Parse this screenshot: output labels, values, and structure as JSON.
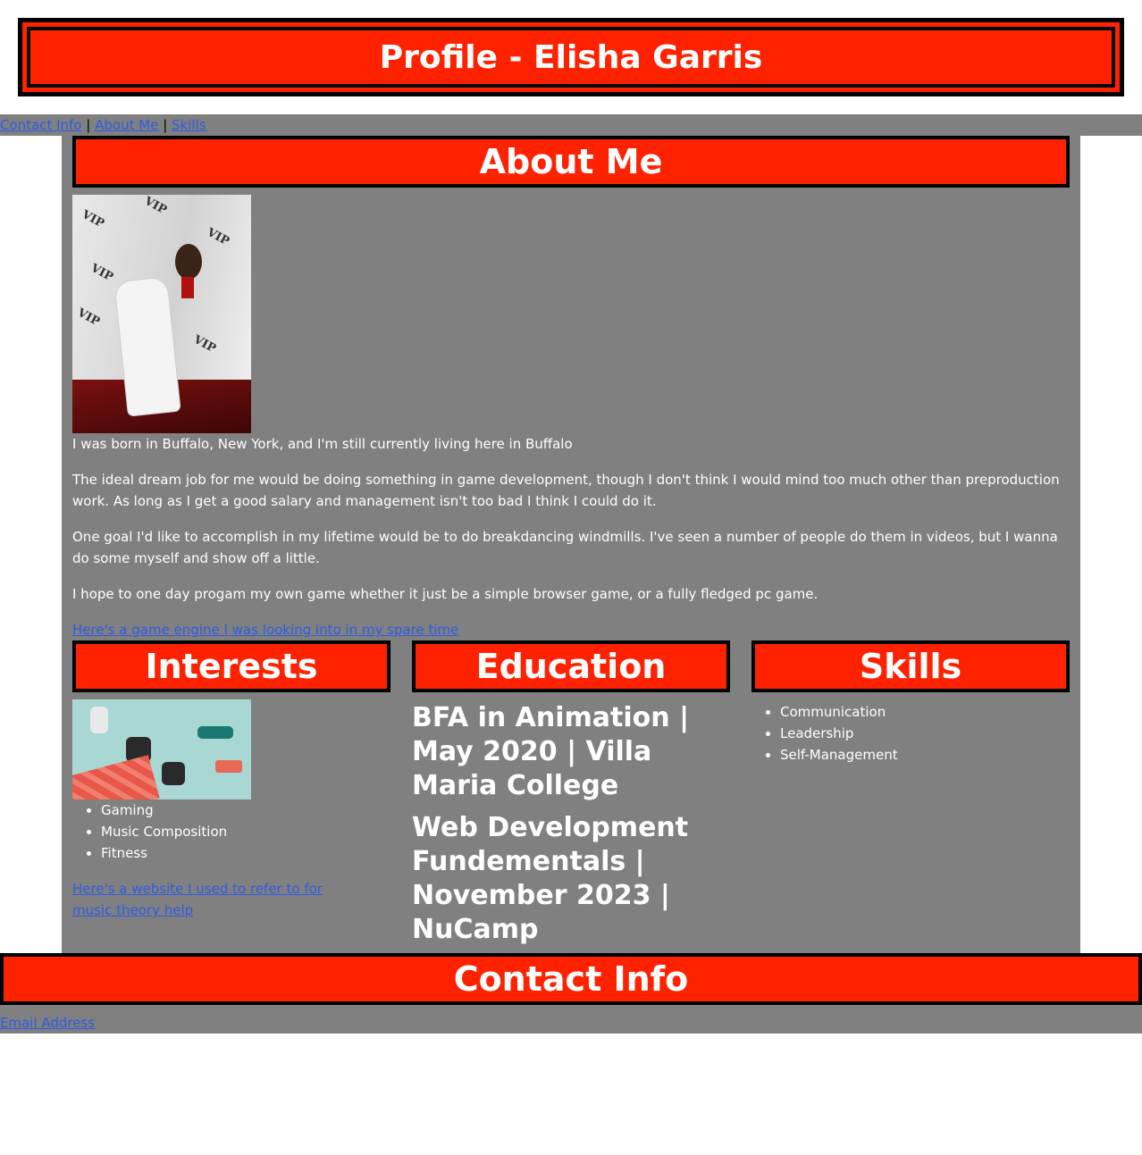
{
  "header": {
    "title": "Profile - Elisha Garris"
  },
  "nav": {
    "contact": "Contact Info",
    "about": "About Me",
    "skills": "Skills",
    "separator": "|"
  },
  "about": {
    "title": "About Me",
    "photo": "portrait-photo",
    "photo_backdrop_text": "VIP",
    "paragraphs": [
      "I was born in Buffalo, New York, and I'm still currently living here in Buffalo",
      "The ideal dream job for me would be doing something in game development, though I don't think I would mind too much other than preproduction work. As long as I get a good salary and management isn't too bad I think I could do it.",
      "One goal I'd like to accomplish in my lifetime would be to do breakdancing windmills. I've seen a number of people do them in videos, but I wanna do some myself and show off a little.",
      "I hope to one day progam my own game whether it just be a simple browser game, or a fully fledged pc game."
    ],
    "link": "Here's a game engine I was looking into in my spare time"
  },
  "interests": {
    "title": "Interests",
    "items": [
      "Gaming",
      "Music Composition",
      "Fitness"
    ],
    "link": "Here's a website I used to refer to for music theory help"
  },
  "education": {
    "title": "Education",
    "items": [
      "BFA in Animation | May 2020 | Villa Maria College",
      "Web Development Fundementals | November 2023 | NuCamp"
    ]
  },
  "skills": {
    "title": "Skills",
    "items": [
      "Communication",
      "Leadership",
      "Self-Management"
    ]
  },
  "contact": {
    "title": "Contact Info",
    "email_link": "Email Address"
  },
  "colors": {
    "accent": "#ff2200",
    "panel": "#808080",
    "link": "#2e5be3",
    "border": "#000000"
  }
}
